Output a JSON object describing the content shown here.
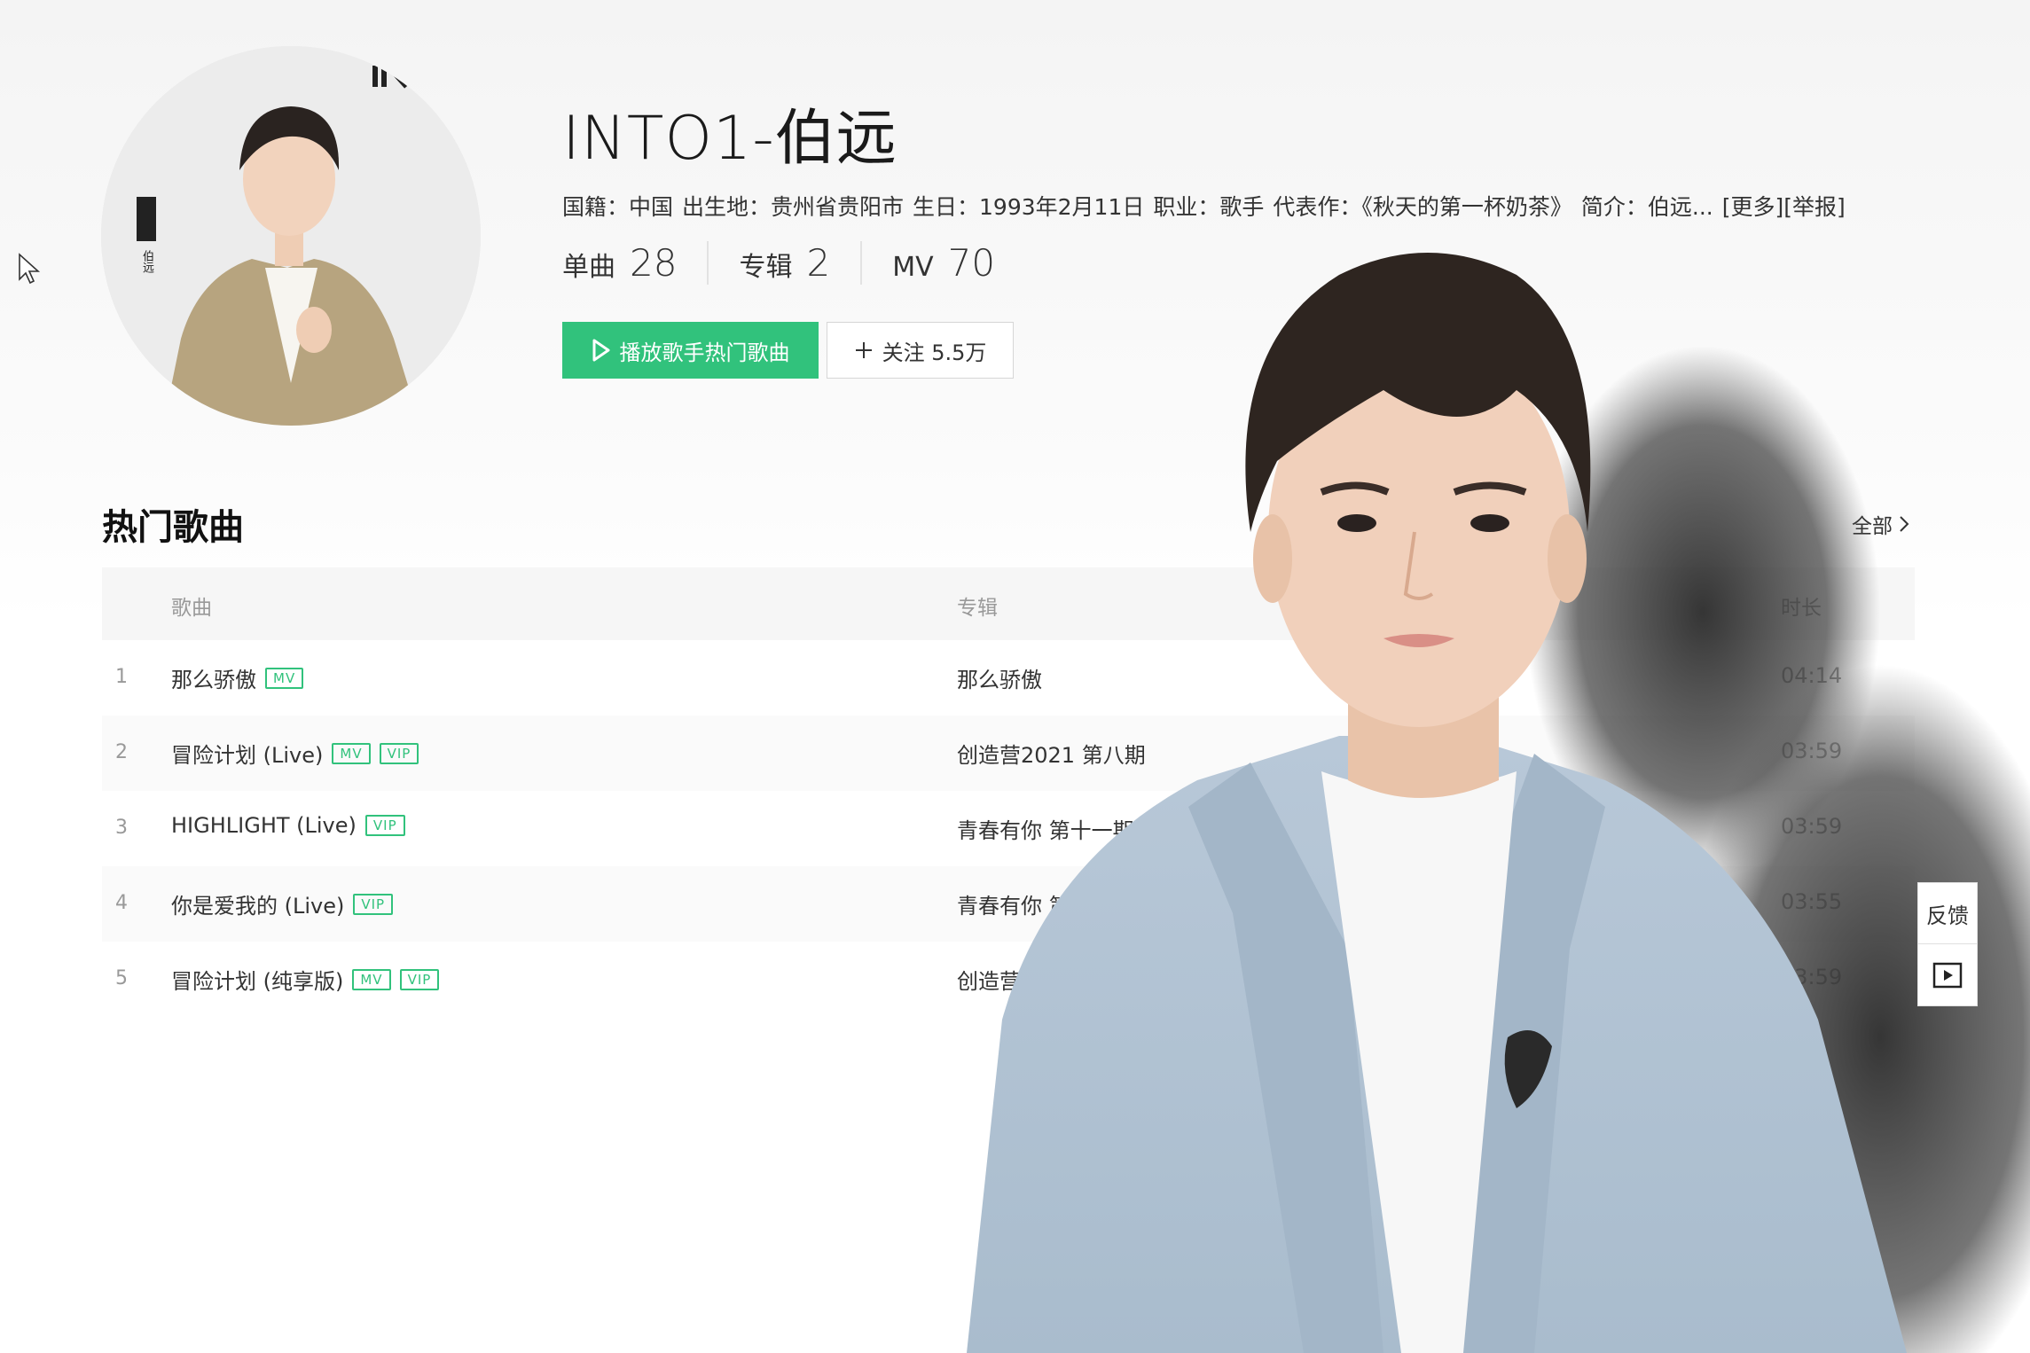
{
  "artist": {
    "name": "INTO1-伯远",
    "meta": {
      "nationality": "国籍：中国",
      "birthplace": "出生地：贵州省贵阳市",
      "birthday": "生日：1993年2月11日",
      "occupation": "职业：歌手",
      "representative": "代表作：《秋天的第一杯奶茶》",
      "intro": "简介：伯远...",
      "more_link": "[更多]",
      "report_link": "[举报]"
    },
    "stats": [
      {
        "label": "单曲",
        "value": "28"
      },
      {
        "label": "专辑",
        "value": "2"
      },
      {
        "label": "MV",
        "value": "70"
      }
    ],
    "avatar_caption": "伯远"
  },
  "actions": {
    "play_label": "播放歌手热门歌曲",
    "follow_label": "关注 5.5万"
  },
  "hot_songs": {
    "title": "热门歌曲",
    "all_label": "全部",
    "columns": {
      "song": "歌曲",
      "album": "专辑",
      "duration": "时长"
    },
    "rows": [
      {
        "idx": "1",
        "name": "那么骄傲",
        "tags": [
          "MV"
        ],
        "album": "那么骄傲",
        "duration": "04:14"
      },
      {
        "idx": "2",
        "name": "冒险计划 (Live)",
        "tags": [
          "MV",
          "VIP"
        ],
        "album": "创造营2021 第八期",
        "duration": "03:59"
      },
      {
        "idx": "3",
        "name": "HIGHLIGHT (Live)",
        "tags": [
          "VIP"
        ],
        "album": "青春有你 第十一期",
        "duration": "03:59"
      },
      {
        "idx": "4",
        "name": "你是爱我的 (Live)",
        "tags": [
          "VIP"
        ],
        "album": "青春有你 第六期",
        "duration": "03:55"
      },
      {
        "idx": "5",
        "name": "冒险计划 (纯享版)",
        "tags": [
          "MV",
          "VIP"
        ],
        "album": "创造营2021 第八期 (纯享版)",
        "duration": "03:59"
      }
    ]
  },
  "side": {
    "feedback_label": "反馈",
    "player_icon": "play-square-icon"
  },
  "colors": {
    "accent": "#31c27c",
    "text": "#333333",
    "muted": "#999999"
  }
}
